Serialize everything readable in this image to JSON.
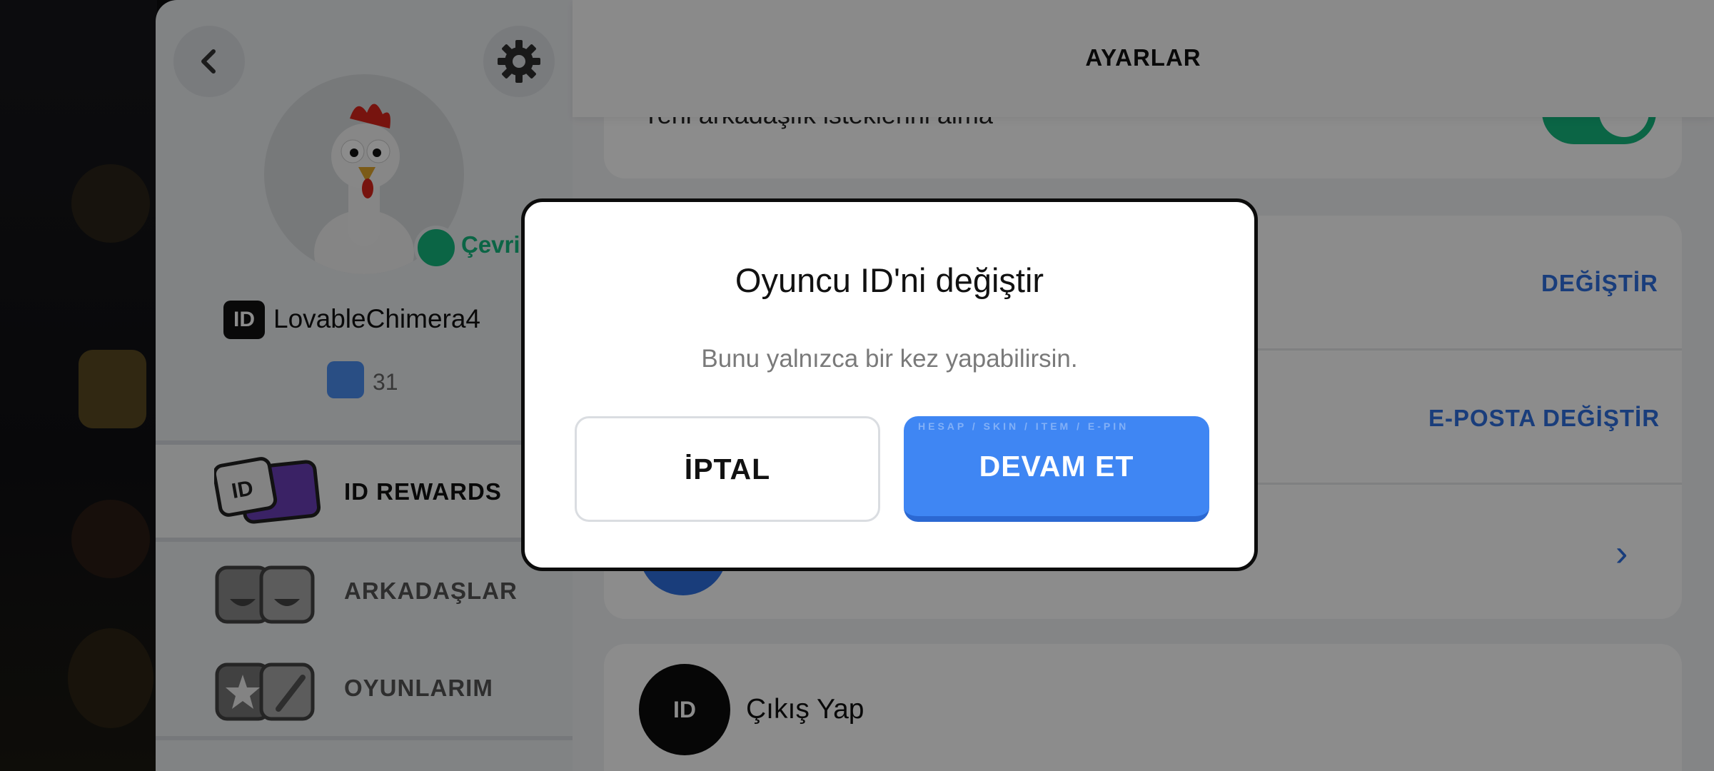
{
  "profile": {
    "online_status": "Çevrimiçi",
    "id_badge": "ID",
    "username": "LovableChimera4",
    "level": "31",
    "menu": [
      {
        "label": "ID REWARDS",
        "icon": "id-rewards-icon"
      },
      {
        "label": "ARKADAŞLAR",
        "icon": "friends-icon"
      },
      {
        "label": "OYUNLARIM",
        "icon": "my-games-icon"
      }
    ]
  },
  "settings": {
    "title": "AYARLAR",
    "friend_requests_label": "Yeni arkadaşlık isteklerini alma",
    "change_label": "DEĞİŞTİR",
    "change_email_label": "E-POSTA DEĞİŞTİR",
    "logout_icon_text": "ID",
    "logout_label": "Çıkış Yap"
  },
  "dialog": {
    "title": "Oyuncu ID'ni değiştir",
    "subtitle": "Bunu yalnızca bir kez yapabilirsin.",
    "cancel_label": "İPTAL",
    "continue_label": "DEVAM ET",
    "watermark": "HESAP / SKIN / ITEM / E-PIN"
  },
  "colors": {
    "accent_blue": "#3f86f3",
    "online_green": "#14b87f",
    "link_blue": "#2f6fe0"
  }
}
